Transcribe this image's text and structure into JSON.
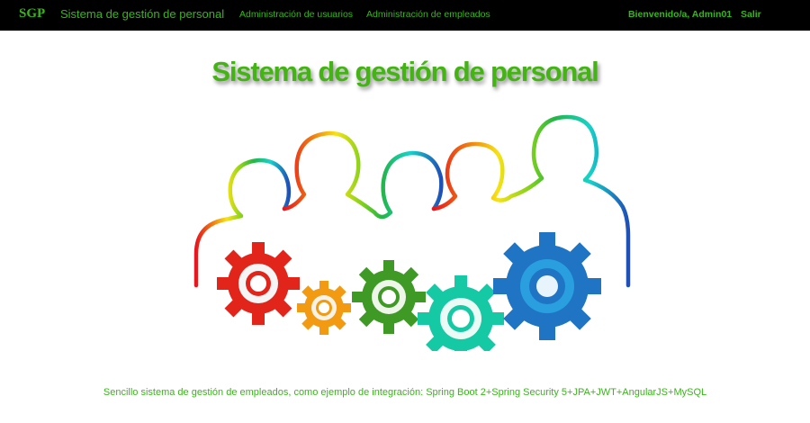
{
  "navbar": {
    "brand": "SGP",
    "title": "Sistema de gestión de personal",
    "links": [
      "Administración de usuarios",
      "Administración de empleados"
    ],
    "welcome": "Bienvenido/a, Admin01",
    "logout": "Salir"
  },
  "main": {
    "title": "Sistema de gestión de personal",
    "hero_icon": "people-gears-illustration",
    "description": "Sencillo sistema de gestión de empleados, como ejemplo de integración: Spring Boot 2+Spring Security 5+JPA+JWT+AngularJS+MySQL"
  },
  "colors": {
    "navbar_bg": "#000000",
    "accent_green": "#39b51a",
    "title_green": "#44b414"
  }
}
